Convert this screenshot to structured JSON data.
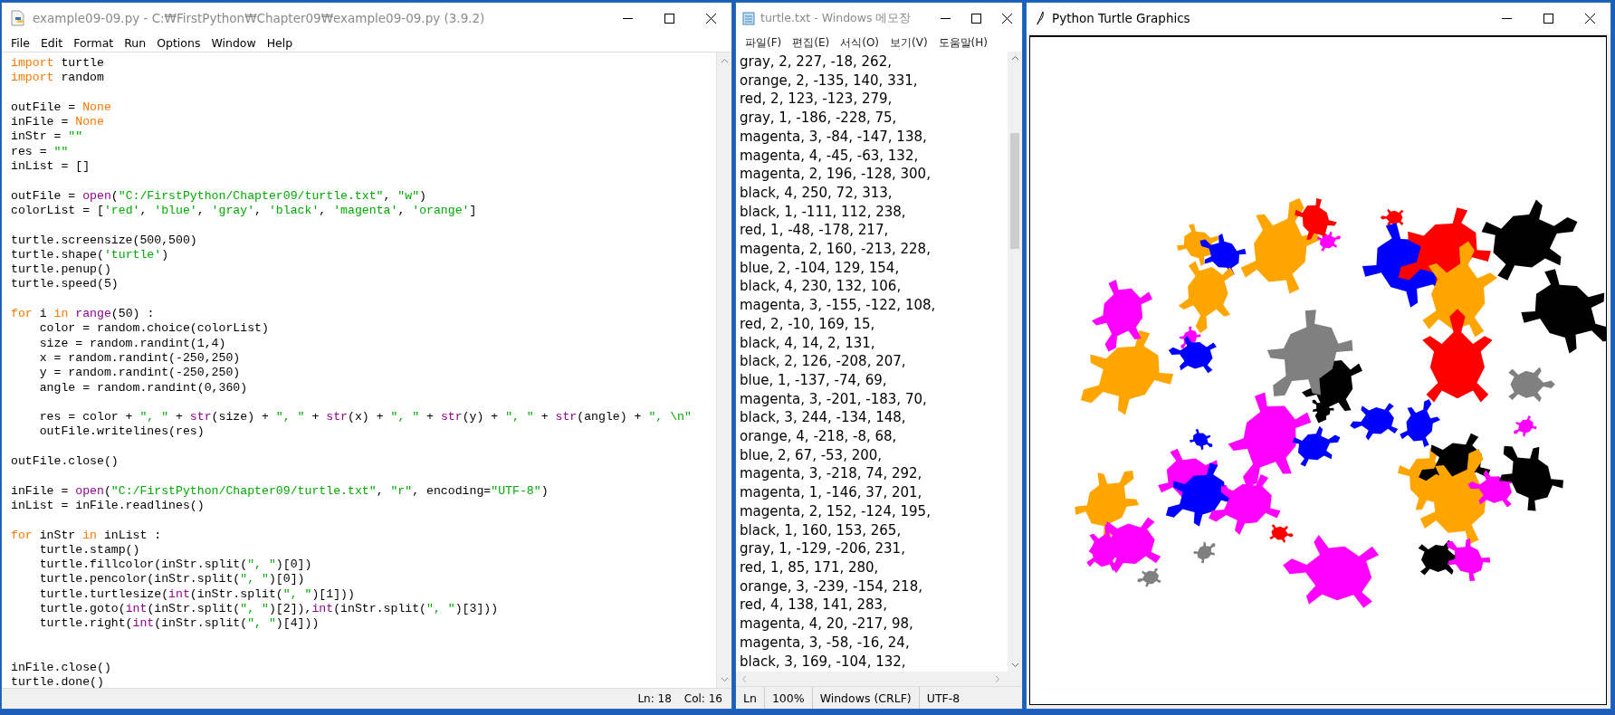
{
  "editor": {
    "title": "example09-09.py - C:₩FirstPython₩Chapter09₩example09-09.py (3.9.2)",
    "menu": [
      "File",
      "Edit",
      "Format",
      "Run",
      "Options",
      "Window",
      "Help"
    ],
    "lines": [
      {
        "kind": "code",
        "tokens": [
          {
            "kind": "keyword",
            "text": "import"
          },
          {
            "kind": "plain",
            "text": " turtle"
          }
        ]
      },
      {
        "kind": "code",
        "tokens": [
          {
            "kind": "keyword",
            "text": "import"
          },
          {
            "kind": "plain",
            "text": " random"
          }
        ]
      },
      {
        "kind": "blank"
      },
      {
        "kind": "code",
        "tokens": [
          {
            "kind": "plain",
            "text": "outFile = "
          },
          {
            "kind": "keyword",
            "text": "None"
          }
        ]
      },
      {
        "kind": "code",
        "tokens": [
          {
            "kind": "plain",
            "text": "inFile = "
          },
          {
            "kind": "keyword",
            "text": "None"
          }
        ]
      },
      {
        "kind": "code",
        "tokens": [
          {
            "kind": "plain",
            "text": "inStr = "
          },
          {
            "kind": "string",
            "text": "\"\""
          }
        ]
      },
      {
        "kind": "code",
        "tokens": [
          {
            "kind": "plain",
            "text": "res = "
          },
          {
            "kind": "string",
            "text": "\"\""
          }
        ]
      },
      {
        "kind": "code",
        "tokens": [
          {
            "kind": "plain",
            "text": "inList = []"
          }
        ]
      },
      {
        "kind": "blank"
      },
      {
        "kind": "code",
        "tokens": [
          {
            "kind": "plain",
            "text": "outFile = "
          },
          {
            "kind": "builtin",
            "text": "open"
          },
          {
            "kind": "plain",
            "text": "("
          },
          {
            "kind": "string",
            "text": "\"C:/FirstPython/Chapter09/turtle.txt\""
          },
          {
            "kind": "plain",
            "text": ", "
          },
          {
            "kind": "string",
            "text": "\"w\""
          },
          {
            "kind": "plain",
            "text": ")"
          }
        ]
      },
      {
        "kind": "code",
        "tokens": [
          {
            "kind": "plain",
            "text": "colorList = ["
          },
          {
            "kind": "string",
            "text": "'red'"
          },
          {
            "kind": "plain",
            "text": ", "
          },
          {
            "kind": "string",
            "text": "'blue'"
          },
          {
            "kind": "plain",
            "text": ", "
          },
          {
            "kind": "string",
            "text": "'gray'"
          },
          {
            "kind": "plain",
            "text": ", "
          },
          {
            "kind": "string",
            "text": "'black'"
          },
          {
            "kind": "plain",
            "text": ", "
          },
          {
            "kind": "string",
            "text": "'magenta'"
          },
          {
            "kind": "plain",
            "text": ", "
          },
          {
            "kind": "string",
            "text": "'orange'"
          },
          {
            "kind": "plain",
            "text": "]"
          }
        ]
      },
      {
        "kind": "blank"
      },
      {
        "kind": "code",
        "tokens": [
          {
            "kind": "plain",
            "text": "turtle.screensize(500,500)"
          }
        ]
      },
      {
        "kind": "code",
        "tokens": [
          {
            "kind": "plain",
            "text": "turtle.shape("
          },
          {
            "kind": "string",
            "text": "'turtle'"
          },
          {
            "kind": "plain",
            "text": ")"
          }
        ]
      },
      {
        "kind": "code",
        "tokens": [
          {
            "kind": "plain",
            "text": "turtle.penup()"
          }
        ]
      },
      {
        "kind": "code",
        "tokens": [
          {
            "kind": "plain",
            "text": "turtle.speed(5)"
          }
        ]
      },
      {
        "kind": "blank"
      },
      {
        "kind": "code",
        "tokens": [
          {
            "kind": "keyword",
            "text": "for"
          },
          {
            "kind": "plain",
            "text": " i "
          },
          {
            "kind": "keyword",
            "text": "in"
          },
          {
            "kind": "builtin",
            "text": " range"
          },
          {
            "kind": "plain",
            "text": "(50) :"
          }
        ]
      },
      {
        "kind": "code",
        "tokens": [
          {
            "kind": "plain",
            "text": "    color = random.choice(colorList)"
          }
        ]
      },
      {
        "kind": "code",
        "tokens": [
          {
            "kind": "plain",
            "text": "    size = random.randint(1,4)"
          }
        ]
      },
      {
        "kind": "code",
        "tokens": [
          {
            "kind": "plain",
            "text": "    x = random.randint(-250,250)"
          }
        ]
      },
      {
        "kind": "code",
        "tokens": [
          {
            "kind": "plain",
            "text": "    y = random.randint(-250,250)"
          }
        ]
      },
      {
        "kind": "code",
        "tokens": [
          {
            "kind": "plain",
            "text": "    angle = random.randint(0,360)"
          }
        ]
      },
      {
        "kind": "blank"
      },
      {
        "kind": "code",
        "tokens": [
          {
            "kind": "plain",
            "text": "    res = color + "
          },
          {
            "kind": "string",
            "text": "\", \""
          },
          {
            "kind": "plain",
            "text": " + "
          },
          {
            "kind": "builtin",
            "text": "str"
          },
          {
            "kind": "plain",
            "text": "(size) + "
          },
          {
            "kind": "string",
            "text": "\", \""
          },
          {
            "kind": "plain",
            "text": " + "
          },
          {
            "kind": "builtin",
            "text": "str"
          },
          {
            "kind": "plain",
            "text": "(x) + "
          },
          {
            "kind": "string",
            "text": "\", \""
          },
          {
            "kind": "plain",
            "text": " + "
          },
          {
            "kind": "builtin",
            "text": "str"
          },
          {
            "kind": "plain",
            "text": "(y) + "
          },
          {
            "kind": "string",
            "text": "\", \""
          },
          {
            "kind": "plain",
            "text": " + "
          },
          {
            "kind": "builtin",
            "text": "str"
          },
          {
            "kind": "plain",
            "text": "(angle) + "
          },
          {
            "kind": "string",
            "text": "\", \\n\""
          }
        ]
      },
      {
        "kind": "code",
        "tokens": [
          {
            "kind": "plain",
            "text": "    outFile.writelines(res)"
          }
        ]
      },
      {
        "kind": "blank"
      },
      {
        "kind": "code",
        "tokens": [
          {
            "kind": "plain",
            "text": "outFile.close()"
          }
        ]
      },
      {
        "kind": "blank"
      },
      {
        "kind": "code",
        "tokens": [
          {
            "kind": "plain",
            "text": "inFile = "
          },
          {
            "kind": "builtin",
            "text": "open"
          },
          {
            "kind": "plain",
            "text": "("
          },
          {
            "kind": "string",
            "text": "\"C:/FirstPython/Chapter09/turtle.txt\""
          },
          {
            "kind": "plain",
            "text": ", "
          },
          {
            "kind": "string",
            "text": "\"r\""
          },
          {
            "kind": "plain",
            "text": ", encoding="
          },
          {
            "kind": "string",
            "text": "\"UTF-8\""
          },
          {
            "kind": "plain",
            "text": ")"
          }
        ]
      },
      {
        "kind": "code",
        "tokens": [
          {
            "kind": "plain",
            "text": "inList = inFile.readlines()"
          }
        ]
      },
      {
        "kind": "blank"
      },
      {
        "kind": "code",
        "tokens": [
          {
            "kind": "keyword",
            "text": "for"
          },
          {
            "kind": "plain",
            "text": " inStr "
          },
          {
            "kind": "keyword",
            "text": "in"
          },
          {
            "kind": "plain",
            "text": " inList :"
          }
        ]
      },
      {
        "kind": "code",
        "tokens": [
          {
            "kind": "plain",
            "text": "    turtle.stamp()"
          }
        ]
      },
      {
        "kind": "code",
        "tokens": [
          {
            "kind": "plain",
            "text": "    turtle.fillcolor(inStr.split("
          },
          {
            "kind": "string",
            "text": "\", \""
          },
          {
            "kind": "plain",
            "text": ")[0])"
          }
        ]
      },
      {
        "kind": "code",
        "tokens": [
          {
            "kind": "plain",
            "text": "    turtle.pencolor(inStr.split("
          },
          {
            "kind": "string",
            "text": "\", \""
          },
          {
            "kind": "plain",
            "text": ")[0])"
          }
        ]
      },
      {
        "kind": "code",
        "tokens": [
          {
            "kind": "plain",
            "text": "    turtle.turtlesize("
          },
          {
            "kind": "builtin",
            "text": "int"
          },
          {
            "kind": "plain",
            "text": "(inStr.split("
          },
          {
            "kind": "string",
            "text": "\", \""
          },
          {
            "kind": "plain",
            "text": ")[1]))"
          }
        ]
      },
      {
        "kind": "code",
        "tokens": [
          {
            "kind": "plain",
            "text": "    turtle.goto("
          },
          {
            "kind": "builtin",
            "text": "int"
          },
          {
            "kind": "plain",
            "text": "(inStr.split("
          },
          {
            "kind": "string",
            "text": "\", \""
          },
          {
            "kind": "plain",
            "text": ")[2]),"
          },
          {
            "kind": "builtin",
            "text": "int"
          },
          {
            "kind": "plain",
            "text": "(inStr.split("
          },
          {
            "kind": "string",
            "text": "\", \""
          },
          {
            "kind": "plain",
            "text": ")[3]))"
          }
        ]
      },
      {
        "kind": "code",
        "tokens": [
          {
            "kind": "plain",
            "text": "    turtle.right("
          },
          {
            "kind": "builtin",
            "text": "int"
          },
          {
            "kind": "plain",
            "text": "(inStr.split("
          },
          {
            "kind": "string",
            "text": "\", \""
          },
          {
            "kind": "plain",
            "text": ")[4]))"
          }
        ]
      },
      {
        "kind": "blank"
      },
      {
        "kind": "blank"
      },
      {
        "kind": "code",
        "tokens": [
          {
            "kind": "plain",
            "text": "inFile.close()"
          }
        ]
      },
      {
        "kind": "code",
        "tokens": [
          {
            "kind": "plain",
            "text": "turtle.done()"
          }
        ]
      }
    ],
    "status": [
      "Ln: 18",
      "Col: 16"
    ]
  },
  "notepad": {
    "title": "turtle.txt - Windows 메모장",
    "menu": [
      "파일(F)",
      "편집(E)",
      "서식(O)",
      "보기(V)",
      "도움말(H)"
    ],
    "lines": [
      "gray, 2, 227, -18, 262,",
      "orange, 2, -135, 140, 331,",
      "red, 2, 123, -123, 279,",
      "gray, 1, -186, -228, 75,",
      "magenta, 3, -84, -147, 138,",
      "magenta, 4, -45, -63, 132,",
      "magenta, 2, 196, -128, 300,",
      "black, 4, 250, 72, 313,",
      "black, 1, -111, 112, 238,",
      "red, 1, -48, -178, 217,",
      "magenta, 2, 160, -213, 228,",
      "blue, 2, -104, 129, 154,",
      "black, 4, 230, 132, 106,",
      "magenta, 3, -155, -122, 108,",
      "red, 2, -10, 169, 15,",
      "black, 4, 14, 2, 131,",
      "black, 2, 126, -208, 207,",
      "blue, 1, -137, -74, 69,",
      "magenta, 3, -201, -183, 70,",
      "black, 3, 244, -134, 148,",
      "orange, 4, -218, -8, 68,",
      "blue, 2, 67, -53, 200,",
      "magenta, 3, -218, 74, 292,",
      "magenta, 1, -146, 37, 201,",
      "magenta, 2, 152, -124, 195,",
      "black, 1, 160, 153, 265,",
      "gray, 1, -129, -206, 231,",
      "red, 1, 85, 171, 280,",
      "orange, 3, -239, -154, 218,",
      "red, 4, 138, 141, 283,",
      "magenta, 4, 20, -217, 98,",
      "magenta, 3, -58, -16, 24,",
      "black, 3, 169, -104, 132,"
    ],
    "status": [
      "Ln",
      "100%",
      "Windows (CRLF)",
      "UTF-8"
    ]
  },
  "turtle_window": {
    "title": "Python Turtle Graphics"
  }
}
